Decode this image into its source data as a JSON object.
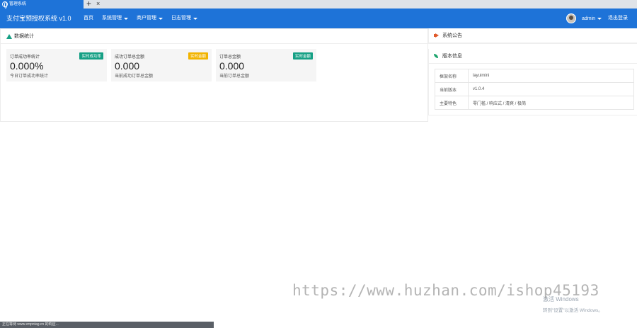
{
  "browser": {
    "tab_title": "管理系统",
    "close_glyph": "×",
    "new_tab_glyph": "+"
  },
  "header": {
    "app_title": "支付宝预授权系统 v1.0",
    "nav": [
      {
        "label": "首页",
        "has_dropdown": false
      },
      {
        "label": "系统管理",
        "has_dropdown": true
      },
      {
        "label": "商户管理",
        "has_dropdown": true
      },
      {
        "label": "日志管理",
        "has_dropdown": true
      }
    ],
    "username": "admin",
    "logout_label": "退出登录"
  },
  "stats": {
    "title": "数据统计",
    "cards": [
      {
        "label": "订单成功率统计",
        "badge": "实时成功率",
        "badge_color": "#16a085",
        "value": "0.000%",
        "sub": "今日订单成功率统计"
      },
      {
        "label": "成功订单总金额",
        "badge": "实时金额",
        "badge_color": "#f2b400",
        "value": "0.000",
        "sub": "当前成功订单总金额"
      },
      {
        "label": "订单总金额",
        "badge": "实时金额",
        "badge_color": "#16a085",
        "value": "0.000",
        "sub": "当前订单总金额"
      }
    ]
  },
  "notice": {
    "title": "系统公告"
  },
  "version": {
    "title": "版本信息",
    "rows": [
      {
        "key": "框架名称",
        "value": "layuimini"
      },
      {
        "key": "当前版本",
        "value": "v1.0.4"
      },
      {
        "key": "主要特色",
        "value": "零门槛 / 响应式 / 清爽 / 极简"
      }
    ]
  },
  "overlay": {
    "activate_title": "激活 Windows",
    "activate_sub": "转到\"设置\"以激活 Windows。",
    "watermark": "https://www.huzhan.com/ishop45193",
    "status": "正在等待 www.xmpntag.cn 的响应..."
  },
  "colors": {
    "accent": "#1e73d8",
    "green": "#16a085",
    "yellow": "#f2b400"
  }
}
